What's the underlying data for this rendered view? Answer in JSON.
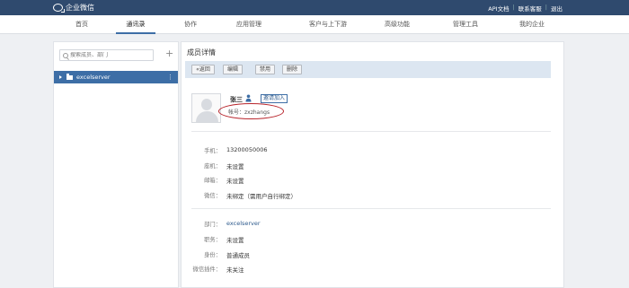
{
  "app": {
    "title": "企业微信"
  },
  "top_links": [
    "API文档",
    "联系客服",
    "退出"
  ],
  "nav": {
    "items": [
      "首页",
      "通讯录",
      "协作",
      "应用管理",
      "客户与上下游",
      "高级功能",
      "管理工具",
      "我的企业"
    ],
    "active_index": 1
  },
  "left": {
    "search_placeholder": "搜索成员、部门",
    "add_symbol": "+",
    "department": "excelserver",
    "more_symbol": "⋮"
  },
  "member": {
    "page_title": "成员详情",
    "toolbar": {
      "back": "«返回",
      "edit": "编辑",
      "disable": "禁用",
      "delete": "删除"
    },
    "name": "张三",
    "invite_label": "邀请加入",
    "account": "帐号：zxzhangs",
    "contact": [
      {
        "label": "手机：",
        "value": "13200050006"
      },
      {
        "label": "座机：",
        "value": "未设置"
      },
      {
        "label": "邮箱：",
        "value": "未设置"
      },
      {
        "label": "微信：",
        "value": "未绑定（需用户自行绑定）"
      }
    ],
    "org": [
      {
        "label": "部门：",
        "value": "excelserver"
      },
      {
        "label": "职务：",
        "value": "未设置"
      },
      {
        "label": "身份：",
        "value": "普通成员"
      },
      {
        "label": "微信插件：",
        "value": "未关注"
      }
    ]
  },
  "colors": {
    "topbar": "#2f4a6e",
    "accent": "#3d6ea6",
    "annotation": "#b8252c"
  }
}
